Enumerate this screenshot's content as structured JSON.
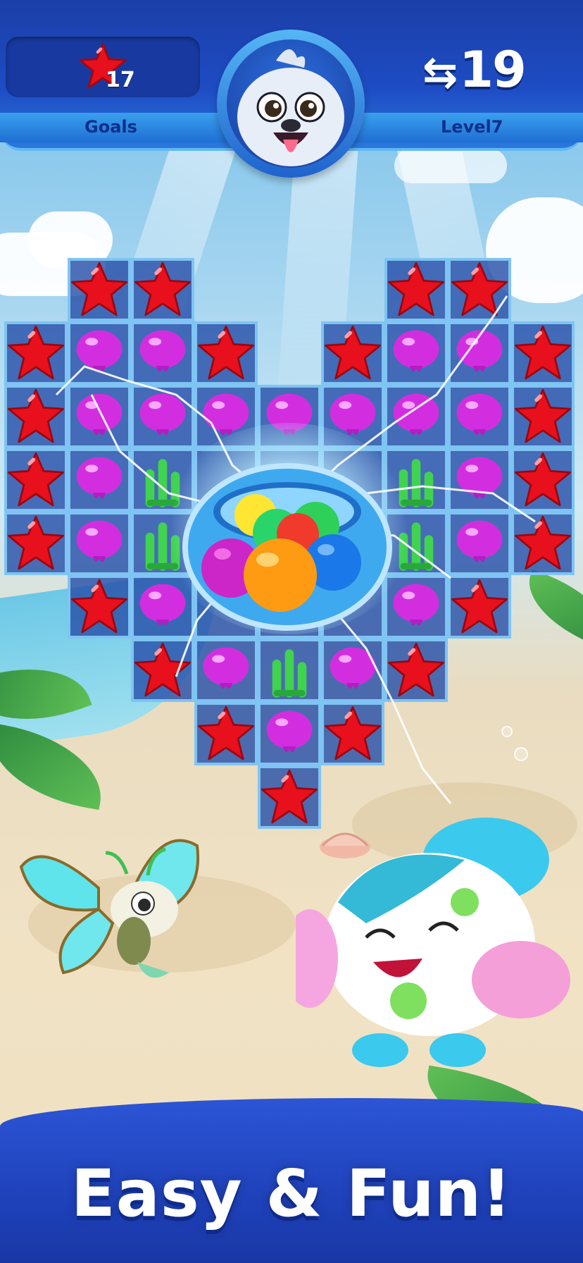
{
  "header": {
    "goals_label": "Goals",
    "goal_count": "17",
    "goal_icon": "red-star-icon",
    "moves_value": "19",
    "moves_icon": "moves-arrows-icon",
    "level_label": "Level7",
    "avatar": "seal-character-avatar"
  },
  "board": {
    "shape": "heart",
    "center_item": "fishbowl-of-colored-balls",
    "rows": [
      [
        "",
        "star",
        "star",
        "",
        "",
        "",
        "star",
        "star",
        ""
      ],
      [
        "star",
        "jelly",
        "jelly",
        "star",
        "",
        "star",
        "jelly",
        "jelly",
        "star"
      ],
      [
        "star",
        "jelly",
        "jelly",
        "jelly",
        "jelly",
        "jelly",
        "jelly",
        "jelly",
        "star"
      ],
      [
        "star",
        "jelly",
        "coral",
        "",
        "",
        "",
        "coral",
        "jelly",
        "star"
      ],
      [
        "star",
        "jelly",
        "coral",
        "",
        "",
        "",
        "coral",
        "jelly",
        "star"
      ],
      [
        "",
        "star",
        "jelly",
        "",
        "",
        "",
        "jelly",
        "star",
        ""
      ],
      [
        "",
        "",
        "star",
        "jelly",
        "coral",
        "jelly",
        "star",
        "",
        ""
      ],
      [
        "",
        "",
        "",
        "star",
        "jelly",
        "star",
        "",
        "",
        ""
      ],
      [
        "",
        "",
        "",
        "",
        "star",
        "",
        "",
        "",
        ""
      ]
    ]
  },
  "colors": {
    "star": "#e8101c",
    "jelly": "#d22ee0",
    "coral": "#3fd34f",
    "header_blue": "#1e4cc4",
    "footer_blue": "#1d3fb6"
  },
  "characters": [
    "butterfly-fish-character",
    "pufferfish-character"
  ],
  "footer": {
    "tagline": "Easy & Fun!"
  }
}
